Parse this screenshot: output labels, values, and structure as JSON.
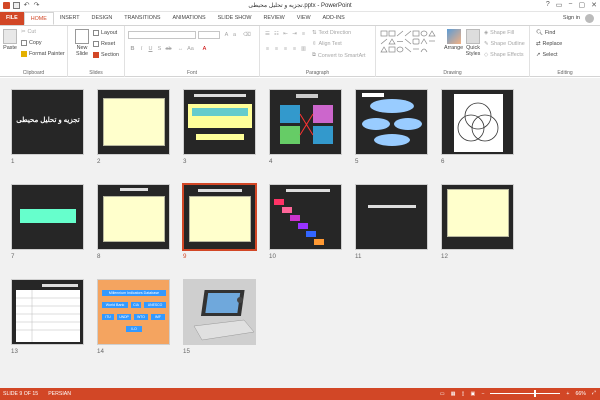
{
  "window": {
    "title": "تجزیه و تحلیل محیطی.pptx - PowerPoint",
    "min": "−",
    "restore": "▢",
    "close": "✕",
    "help": "?",
    "options": "▭"
  },
  "tabs": [
    {
      "label": "FILE"
    },
    {
      "label": "HOME"
    },
    {
      "label": "INSERT"
    },
    {
      "label": "DESIGN"
    },
    {
      "label": "TRANSITIONS"
    },
    {
      "label": "ANIMATIONS"
    },
    {
      "label": "SLIDE SHOW"
    },
    {
      "label": "REVIEW"
    },
    {
      "label": "VIEW"
    },
    {
      "label": "ADD-INS"
    }
  ],
  "account": {
    "signin": "Sign in"
  },
  "ribbon": {
    "clipboard": {
      "label": "Clipboard",
      "paste": "Paste",
      "cut": "Cut",
      "copy": "Copy",
      "painter": "Format Painter"
    },
    "slides": {
      "label": "Slides",
      "new_slide": "New Slide",
      "layout": "Layout",
      "reset": "Reset",
      "section": "Section"
    },
    "font": {
      "label": "Font"
    },
    "paragraph": {
      "label": "Paragraph",
      "text_direction": "Text Direction",
      "align_text": "Align Text",
      "smartart": "Convert to SmartArt"
    },
    "drawing": {
      "label": "Drawing",
      "arrange": "Arrange",
      "quick_styles": "Quick Styles",
      "fill": "Shape Fill",
      "outline": "Shape Outline",
      "effects": "Shape Effects"
    },
    "editing": {
      "label": "Editing",
      "find": "Find",
      "replace": "Replace",
      "select": "Select"
    }
  },
  "slides": [
    {
      "n": "1",
      "title": "تجزیه و تحلیل محیطی"
    },
    {
      "n": "2",
      "title": ""
    },
    {
      "n": "3",
      "title": ""
    },
    {
      "n": "4",
      "title": ""
    },
    {
      "n": "5",
      "title": ""
    },
    {
      "n": "6",
      "title": ""
    },
    {
      "n": "7",
      "title": ""
    },
    {
      "n": "8",
      "title": ""
    },
    {
      "n": "9",
      "title": ""
    },
    {
      "n": "10",
      "title": ""
    },
    {
      "n": "11",
      "title": ""
    },
    {
      "n": "12",
      "title": ""
    },
    {
      "n": "13",
      "title": ""
    },
    {
      "n": "14",
      "title": "Millennium Indicators Database"
    },
    {
      "n": "15",
      "title": ""
    }
  ],
  "slide14": {
    "wb": "World Bank",
    "cia": "CIA",
    "unesco": "UNESCO",
    "itu": "ITU",
    "undp": "UNDP",
    "wto": "WTO",
    "imf": "IMF",
    "ilo": "ILO"
  },
  "status": {
    "slide": "SLIDE 9 OF 15",
    "lang": "PERSIAN",
    "notes": "",
    "zoom": "66%",
    "minus": "−",
    "plus": "+"
  },
  "colors": {
    "accent": "#d24726"
  }
}
